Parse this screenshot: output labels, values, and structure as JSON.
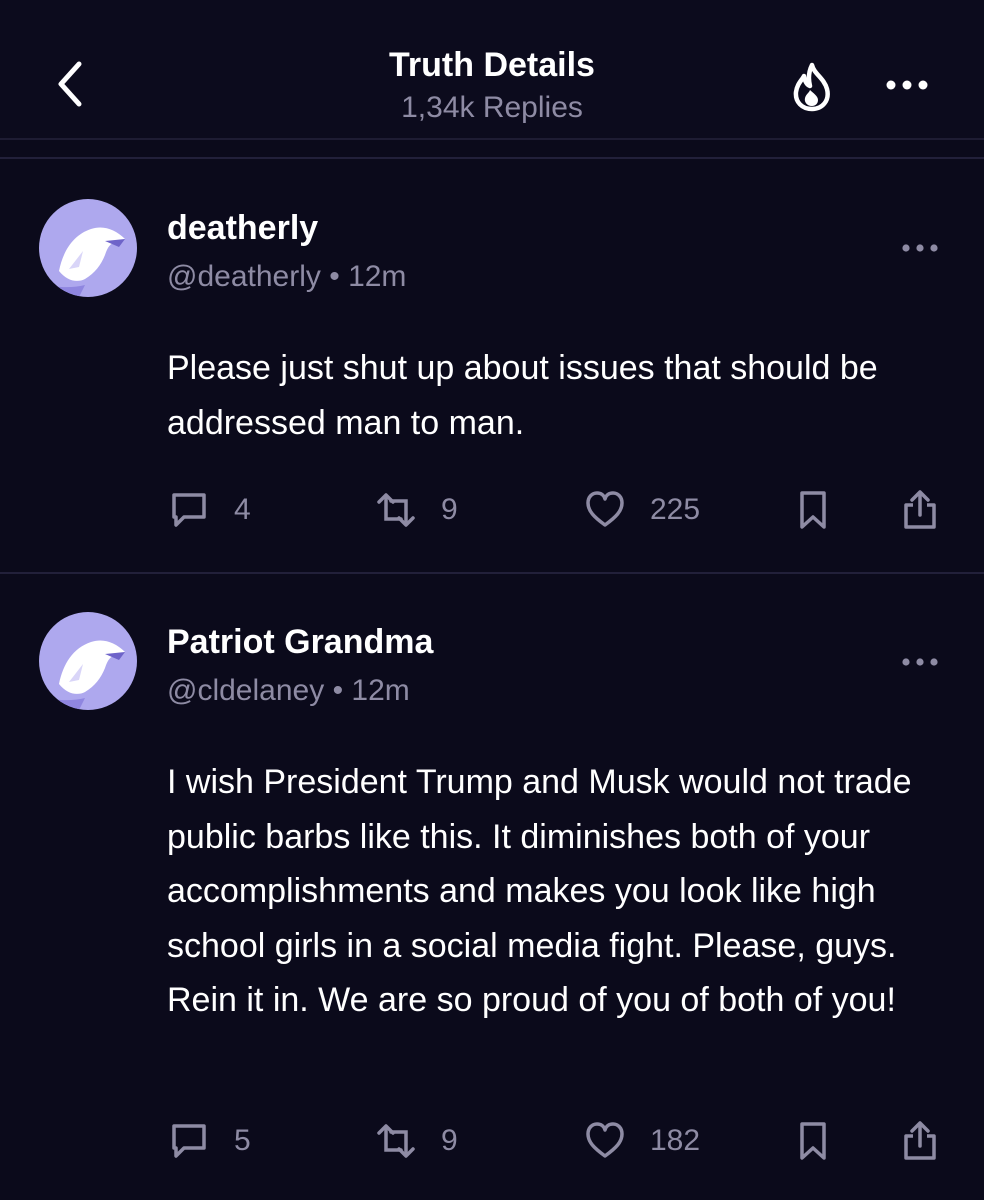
{
  "header": {
    "title": "Truth Details",
    "subtitle": "1,34k Replies"
  },
  "posts": [
    {
      "display_name": "deatherly",
      "handle": "@deatherly",
      "time": "12m",
      "text": "Please just shut up about issues that should be addressed man to man.",
      "replies": "4",
      "retruths": "9",
      "likes": "225"
    },
    {
      "display_name": "Patriot Grandma",
      "handle": "@cldelaney",
      "time": "12m",
      "text": "I wish President Trump and Musk would not trade public barbs like this. It diminishes both of your accomplishments and makes you look like high school girls in a social media fight. Please, guys. Rein it in. We are so proud of you of both of you!",
      "replies": "5",
      "retruths": "9",
      "likes": "182"
    }
  ],
  "colors": {
    "background": "#0b0a1b",
    "muted_text": "#8e8ba4",
    "avatar_bg": "#aea8ee",
    "divider": "#22203a"
  }
}
